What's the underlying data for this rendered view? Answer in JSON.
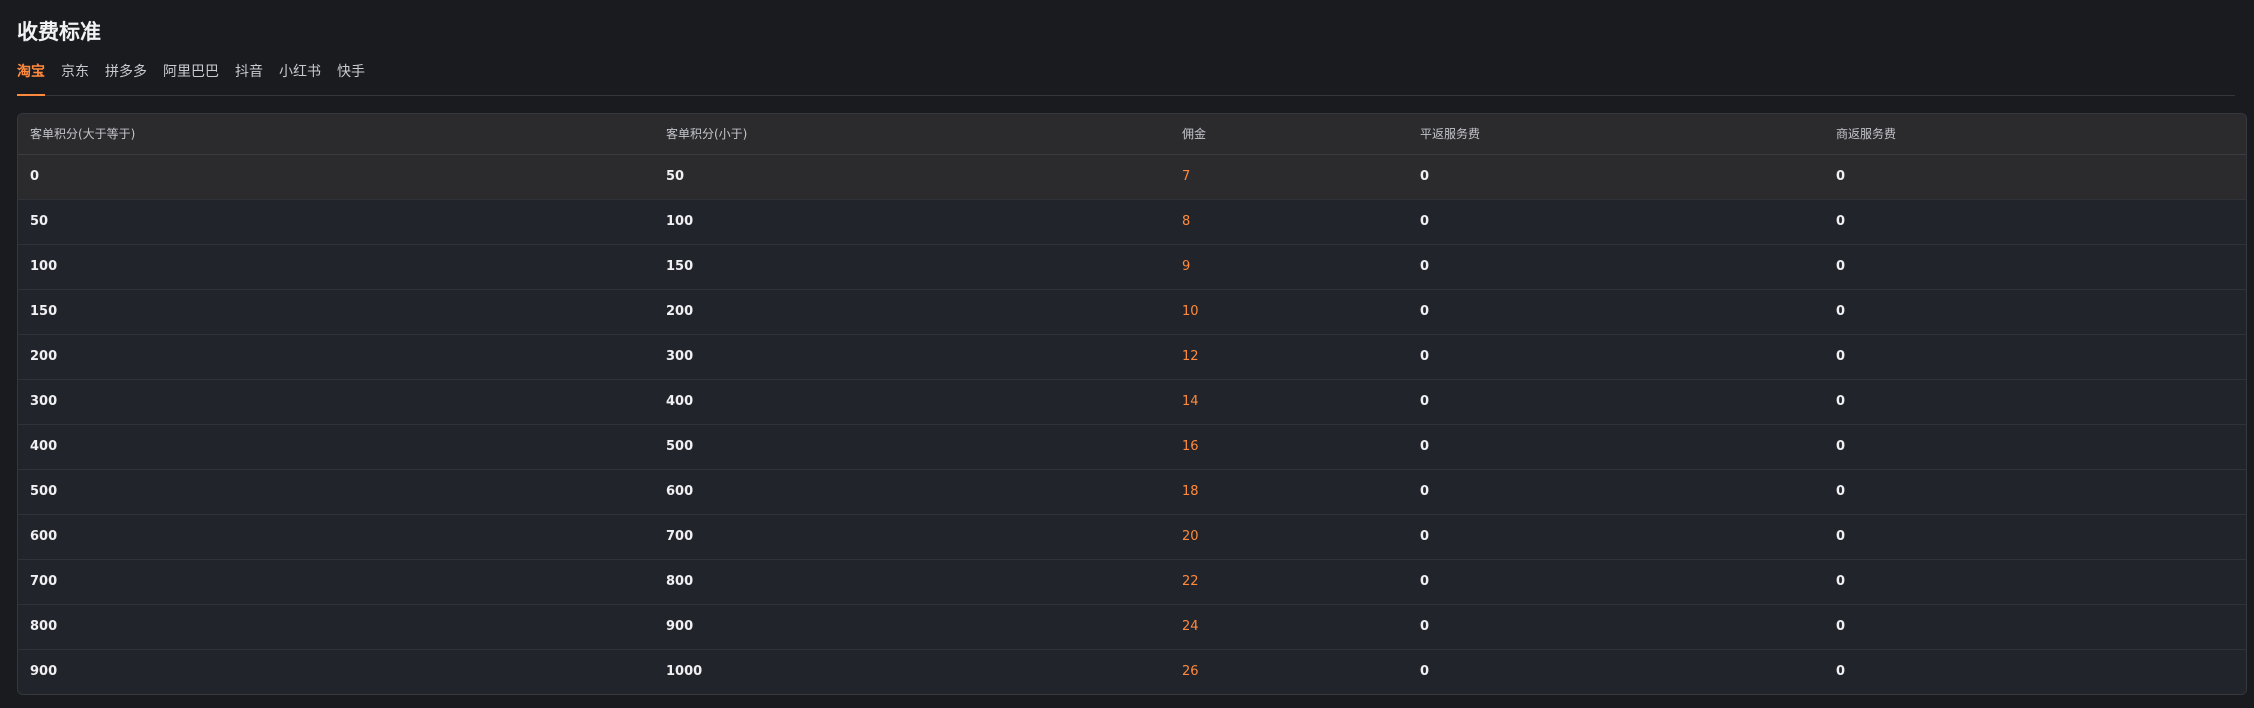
{
  "title": "收费标准",
  "tabs": [
    {
      "label": "淘宝",
      "active": true
    },
    {
      "label": "京东",
      "active": false
    },
    {
      "label": "拼多多",
      "active": false
    },
    {
      "label": "阿里巴巴",
      "active": false
    },
    {
      "label": "抖音",
      "active": false
    },
    {
      "label": "小红书",
      "active": false
    },
    {
      "label": "快手",
      "active": false
    }
  ],
  "colors": {
    "accent": "#ff8a3d",
    "background": "#1a1b1f"
  },
  "table": {
    "headers": [
      "客单积分(大于等于)",
      "客单积分(小于)",
      "佣金",
      "平返服务费",
      "商返服务费"
    ],
    "rows": [
      [
        "0",
        "50",
        "7",
        "0",
        "0"
      ],
      [
        "50",
        "100",
        "8",
        "0",
        "0"
      ],
      [
        "100",
        "150",
        "9",
        "0",
        "0"
      ],
      [
        "150",
        "200",
        "10",
        "0",
        "0"
      ],
      [
        "200",
        "300",
        "12",
        "0",
        "0"
      ],
      [
        "300",
        "400",
        "14",
        "0",
        "0"
      ],
      [
        "400",
        "500",
        "16",
        "0",
        "0"
      ],
      [
        "500",
        "600",
        "18",
        "0",
        "0"
      ],
      [
        "600",
        "700",
        "20",
        "0",
        "0"
      ],
      [
        "700",
        "800",
        "22",
        "0",
        "0"
      ],
      [
        "800",
        "900",
        "24",
        "0",
        "0"
      ],
      [
        "900",
        "1000",
        "26",
        "0",
        "0"
      ]
    ]
  }
}
